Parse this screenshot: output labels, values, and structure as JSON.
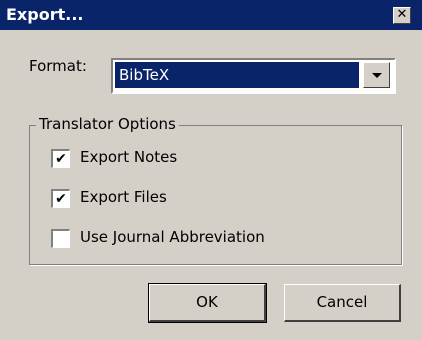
{
  "window": {
    "title": "Export...",
    "close_glyph": "✕"
  },
  "format": {
    "label": "Format:",
    "selected": "BibTeX"
  },
  "translator_options": {
    "legend": "Translator Options",
    "options": [
      {
        "label": "Export Notes",
        "checked": true
      },
      {
        "label": "Export Files",
        "checked": true
      },
      {
        "label": "Use Journal Abbreviation",
        "checked": false
      }
    ]
  },
  "buttons": {
    "ok": "OK",
    "cancel": "Cancel"
  },
  "colors": {
    "title_bar": "#0a246a",
    "dialog_bg": "#d4d0c8",
    "selection": "#0a246a"
  },
  "icons": {
    "close": "close-icon",
    "dropdown": "chevron-down-icon",
    "check": "checkmark-icon"
  }
}
